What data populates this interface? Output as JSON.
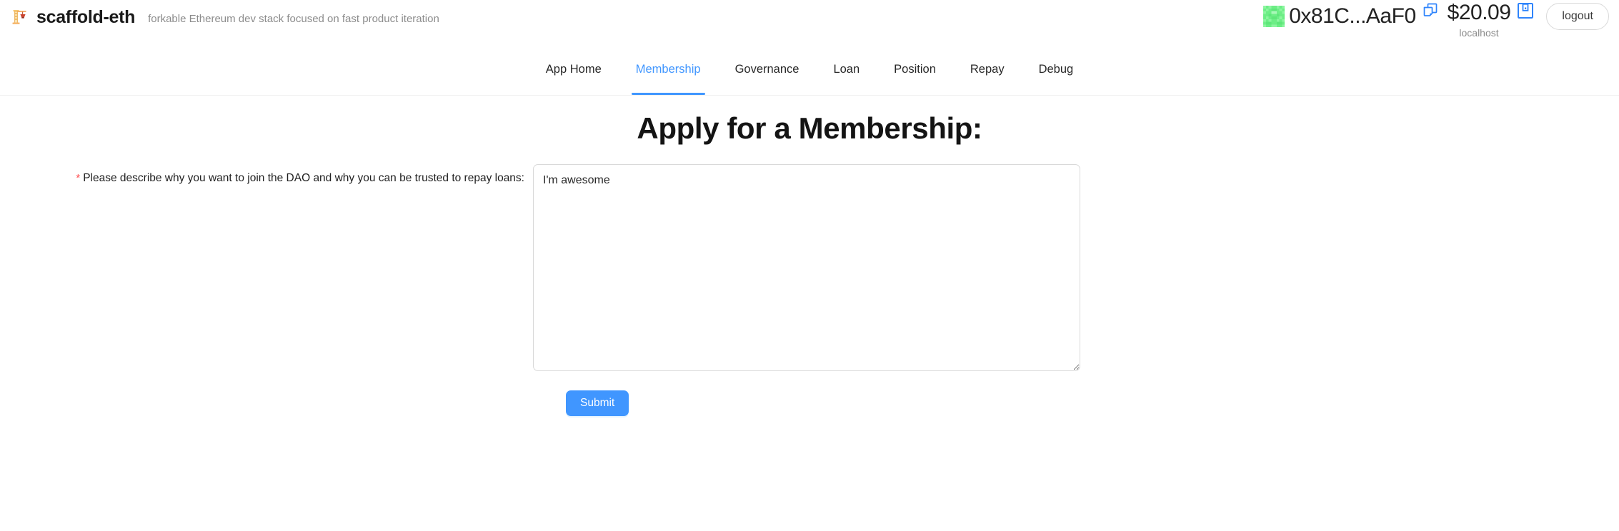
{
  "header": {
    "logo_icon": "construction-crane-icon",
    "brand_title": "scaffold-eth",
    "tagline": "forkable Ethereum dev stack focused on fast product iteration",
    "account": {
      "avatar_icon": "blockie-avatar",
      "address": "0x81C...AaF0",
      "copy_icon": "copy-icon",
      "balance": "$20.09",
      "network": "localhost",
      "save_icon": "save-icon",
      "logout_label": "logout"
    }
  },
  "nav": {
    "tabs": [
      {
        "label": "App Home",
        "active": false
      },
      {
        "label": "Membership",
        "active": true
      },
      {
        "label": "Governance",
        "active": false
      },
      {
        "label": "Loan",
        "active": false
      },
      {
        "label": "Position",
        "active": false
      },
      {
        "label": "Repay",
        "active": false
      },
      {
        "label": "Debug",
        "active": false
      }
    ]
  },
  "main": {
    "page_title": "Apply for a Membership:",
    "form": {
      "required_mark": "*",
      "label": "Please describe why you want to join the DAO and why you can be trusted to repay loans:",
      "textarea_value": "I'm awesome",
      "textarea_placeholder": "",
      "submit_label": "Submit"
    }
  },
  "colors": {
    "accent": "#4096ff",
    "required": "#ff4d4f",
    "muted_text": "#8c8c8c",
    "border": "#d9d9d9",
    "divider": "#f0f0f0",
    "blockie_primary": "#6dee86",
    "blockie_secondary": "#8df5a0"
  }
}
